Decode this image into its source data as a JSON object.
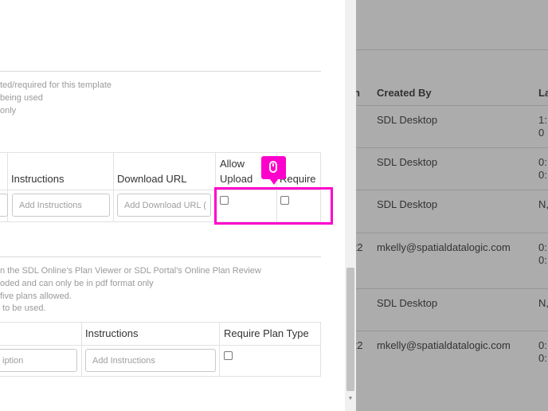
{
  "background_table": {
    "headers": {
      "col_partial": "n",
      "created_by": "Created By",
      "col_last": "La"
    },
    "rows": [
      {
        "partial": "",
        "created_by": "SDL Desktop",
        "last_1": "1:",
        "last_2": "0"
      },
      {
        "partial": "",
        "created_by": "SDL Desktop",
        "last_1": "0:",
        "last_2": "0:"
      },
      {
        "partial": "",
        "created_by": "SDL Desktop",
        "last_1": "N,",
        "last_2": ""
      },
      {
        "partial": "22",
        "created_by": "mkelly@spatialdatalogic.com",
        "last_1": "0:",
        "last_2": "0:"
      },
      {
        "partial": "",
        "created_by": "SDL Desktop",
        "last_1": "N,",
        "last_2": ""
      },
      {
        "partial": "22",
        "created_by": "mkelly@spatialdatalogic.com",
        "last_1": "0:",
        "last_2": "0:"
      }
    ]
  },
  "documents_section": {
    "notes": [
      "ted/required for this template",
      "being used",
      "only"
    ],
    "headers": {
      "instructions": "Instructions",
      "download_url": "Download URL",
      "allow_upload_line1": "Allow",
      "allow_upload_line2": "Upload",
      "require": "Require"
    },
    "instructions_placeholder": "Add Instructions",
    "download_url_placeholder": "Add Download URL (",
    "allow_upload_checked": false,
    "require_checked": false
  },
  "plans_section": {
    "notes": [
      "n the SDL Online's Plan Viewer or SDL Portal's Online Plan Review",
      "oded and can only be in pdf format only",
      "five plans allowed.",
      " to be used."
    ],
    "headers": {
      "instructions": "Instructions",
      "require_plan_type": "Require Plan Type"
    },
    "description_placeholder": "iption",
    "instructions_placeholder": "Add Instructions",
    "require_plan_type_checked": false
  },
  "annotation": {
    "highlight_color": "#ff00cc",
    "cursor_icon": "mouse-icon"
  }
}
